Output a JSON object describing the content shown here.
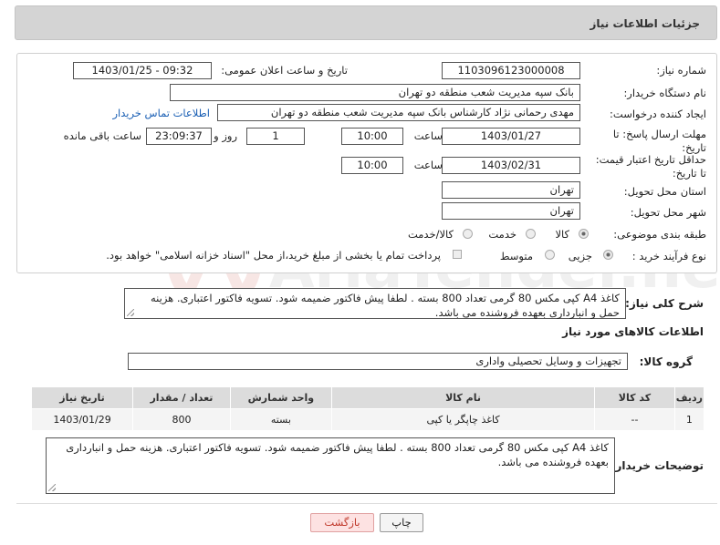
{
  "header": {
    "title": "جزئیات اطلاعات نیاز"
  },
  "form": {
    "need_number_label": "شماره نیاز:",
    "need_number": "1103096123000008",
    "announce_label": "تاریخ و ساعت اعلان عمومی:",
    "announce_value": "1403/01/25 - 09:32",
    "buyer_org_label": "نام دستگاه خریدار:",
    "buyer_org": "بانک سپه مدیریت شعب منطقه دو تهران",
    "creator_label": "ایجاد کننده درخواست:",
    "creator": "مهدی رحمانی نژاد کارشناس بانک سپه مدیریت شعب منطقه دو تهران",
    "contact_link": "اطلاعات تماس خریدار",
    "deadline_label": "مهلت ارسال پاسخ: تا تاریخ:",
    "deadline_date": "1403/01/27",
    "time_label": "ساعت",
    "deadline_time": "10:00",
    "days_value": "1",
    "day_and_label": "روز و",
    "remaining_time": "23:09:37",
    "remaining_label": "ساعت باقی مانده",
    "min_validity_label": "حداقل تاریخ اعتبار قیمت: تا تاریخ:",
    "validity_date": "1403/02/31",
    "validity_time": "10:00",
    "province_label": "استان محل تحویل:",
    "province": "تهران",
    "city_label": "شهر محل تحویل:",
    "city": "تهران",
    "category_label": "طبقه بندی موضوعی:",
    "category_options": [
      "کالا",
      "خدمت",
      "کالا/خدمت"
    ],
    "purchase_type_label": "نوع فرآیند خرید :",
    "purchase_options": [
      "جزیی",
      "متوسط"
    ],
    "payment_note": "پرداخت تمام یا بخشی از مبلغ خرید،از محل \"اسناد خزانه اسلامی\" خواهد بود."
  },
  "general_description": {
    "label": "شرح کلی نیاز:",
    "text": "کاغذ A4 کپی مکس 80 گرمی تعداد 800 بسته . لطفا پیش فاکتور ضمیمه شود. تسویه فاکتور  اعتباری. هزینه حمل و انبارداری بعهده فروشنده می باشد."
  },
  "goods_info": {
    "title": "اطلاعات کالاهای مورد نیاز",
    "group_label": "گروه کالا:",
    "group_value": "تجهیزات و وسایل تحصیلی واداری",
    "columns": [
      "ردیف",
      "کد کالا",
      "نام کالا",
      "واحد شمارش",
      "تعداد / مقدار",
      "تاریخ نیاز"
    ],
    "rows": [
      [
        "1",
        "--",
        "کاغذ چاپگر یا کپی",
        "بسته",
        "800",
        "1403/01/29"
      ]
    ]
  },
  "buyer_notes": {
    "label": "توضیحات خریدار:",
    "text": "کاغذ A4 کپی مکس 80 گرمی تعداد 800 بسته . لطفا پیش فاکتور ضمیمه شود. تسویه فاکتور  اعتباری. هزینه حمل و انبارداری بعهده فروشنده می باشد."
  },
  "buttons": {
    "print": "چاپ",
    "back": "بازگشت"
  },
  "watermark": {
    "text": "AriaTender.neT"
  },
  "colors": {
    "link": "#1a5fb4",
    "back_button_bg": "#fde2e2",
    "back_button_text": "#c0392b",
    "header_bg": "#d4d4d4"
  }
}
